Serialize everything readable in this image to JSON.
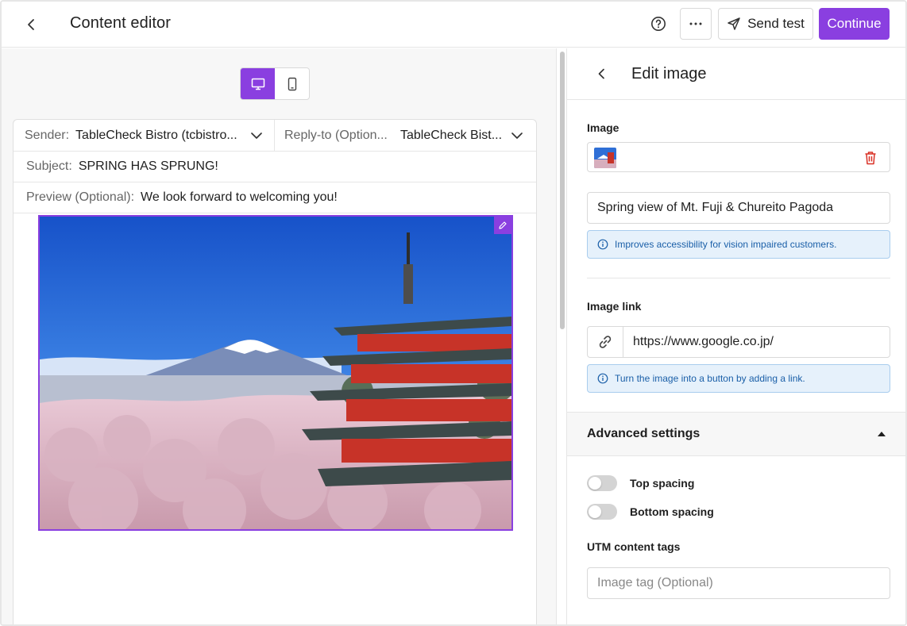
{
  "header": {
    "title": "Content editor",
    "send_test_label": "Send test",
    "continue_label": "Continue",
    "icons": {
      "back": "chevron-left-icon",
      "help": "help-circle-icon",
      "more": "more-horizontal-icon",
      "send": "paper-plane-icon"
    }
  },
  "editor": {
    "device_modes": [
      "desktop",
      "mobile"
    ],
    "selected_device": "desktop",
    "sender_label": "Sender:",
    "sender_value": "TableCheck Bistro (tcbistro...",
    "replyto_label": "Reply-to (Option...",
    "replyto_value": "TableCheck Bist...",
    "subject_label": "Subject:",
    "subject_value": "SPRING HAS SPRUNG!",
    "preview_label": "Preview (Optional):",
    "preview_value": "We look forward to welcoming you!"
  },
  "panel": {
    "title": "Edit image",
    "image_label": "Image",
    "alt_text": "Spring view of Mt. Fuji & Chureito Pagoda",
    "alt_info": "Improves accessibility for vision impaired customers.",
    "link_label": "Image link",
    "link_value": "https://www.google.co.jp/",
    "link_info": "Turn the image into a button by adding a link.",
    "advanced_title": "Advanced settings",
    "advanced_expanded": true,
    "top_spacing_label": "Top spacing",
    "top_spacing_on": false,
    "bottom_spacing_label": "Bottom spacing",
    "bottom_spacing_on": false,
    "utm_label": "UTM content tags",
    "utm_placeholder": "Image tag (Optional)",
    "utm_value": ""
  },
  "colors": {
    "accent": "#8a3fe0",
    "info_bg": "#e6f1fb",
    "info_text": "#1a5fa8",
    "danger": "#d93025"
  }
}
